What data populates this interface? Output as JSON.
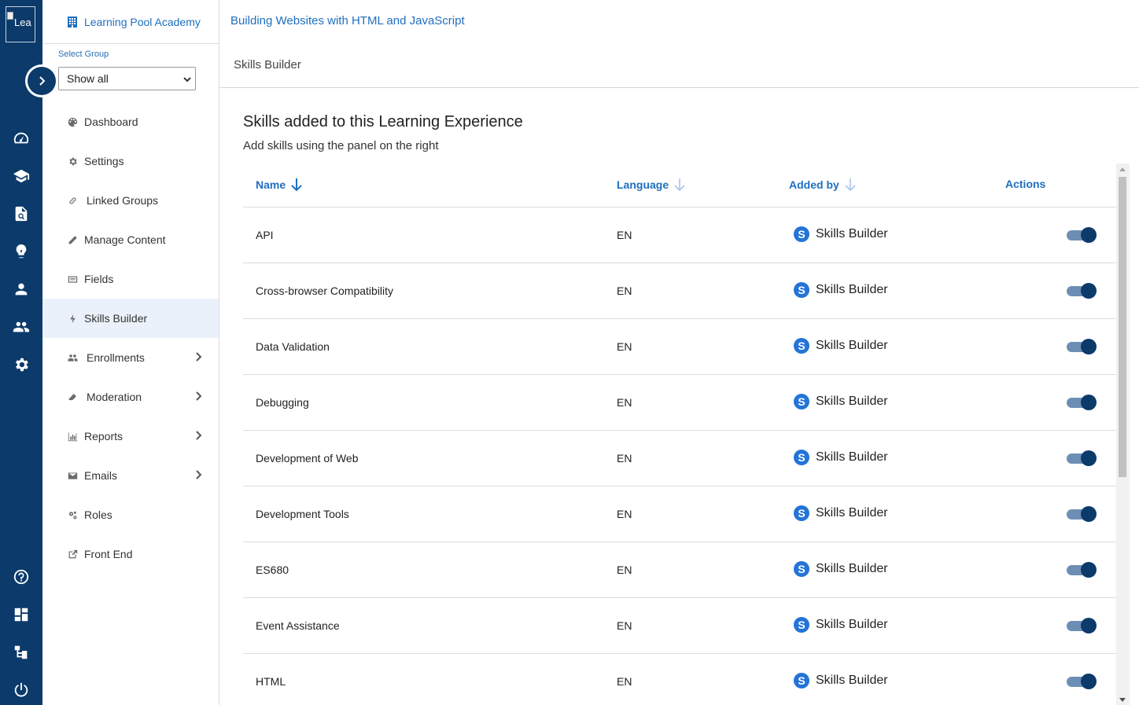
{
  "rail": {
    "logo_alt": "Lea",
    "icons": [
      "dashboard-gauge-icon",
      "graduation-cap-icon",
      "document-search-icon",
      "lightbulb-icon",
      "person-icon",
      "people-icon",
      "gear-icon",
      "help-circle-icon",
      "grid-icon",
      "hierarchy-icon",
      "power-icon"
    ]
  },
  "subnav": {
    "academy": "Learning Pool Academy",
    "group_label": "Select Group",
    "group_select_value": "Show all",
    "items": [
      {
        "label": "Dashboard",
        "icon": "palette-icon",
        "has_children": false,
        "active": false
      },
      {
        "label": "Settings",
        "icon": "gear-icon",
        "has_children": false,
        "active": false
      },
      {
        "label": "Linked Groups",
        "icon": "link-icon",
        "has_children": false,
        "active": false
      },
      {
        "label": "Manage Content",
        "icon": "pencil-icon",
        "has_children": false,
        "active": false
      },
      {
        "label": "Fields",
        "icon": "list-box-icon",
        "has_children": false,
        "active": false
      },
      {
        "label": "Skills Builder",
        "icon": "bolt-icon",
        "has_children": false,
        "active": true
      },
      {
        "label": "Enrollments",
        "icon": "users-icon",
        "has_children": true,
        "active": false
      },
      {
        "label": "Moderation",
        "icon": "eraser-icon",
        "has_children": true,
        "active": false
      },
      {
        "label": "Reports",
        "icon": "bar-chart-icon",
        "has_children": true,
        "active": false
      },
      {
        "label": "Emails",
        "icon": "envelope-icon",
        "has_children": true,
        "active": false
      },
      {
        "label": "Roles",
        "icon": "cogs-icon",
        "has_children": false,
        "active": false
      },
      {
        "label": "Front End",
        "icon": "external-link-icon",
        "has_children": false,
        "active": false
      }
    ]
  },
  "main": {
    "course_title": "Building Websites with HTML and JavaScript",
    "page_title": "Skills Builder",
    "section_title": "Skills added to this Learning Experience",
    "section_subtitle": "Add skills using the panel on the right",
    "table": {
      "headers": {
        "name": "Name",
        "language": "Language",
        "added_by": "Added by",
        "actions": "Actions"
      },
      "rows": [
        {
          "name": "API",
          "language": "EN",
          "added_by": "Skills Builder",
          "enabled": true
        },
        {
          "name": "Cross-browser Compatibility",
          "language": "EN",
          "added_by": "Skills Builder",
          "enabled": true
        },
        {
          "name": "Data Validation",
          "language": "EN",
          "added_by": "Skills Builder",
          "enabled": true
        },
        {
          "name": "Debugging",
          "language": "EN",
          "added_by": "Skills Builder",
          "enabled": true
        },
        {
          "name": "Development of Web",
          "language": "EN",
          "added_by": "Skills Builder",
          "enabled": true
        },
        {
          "name": "Development Tools",
          "language": "EN",
          "added_by": "Skills Builder",
          "enabled": true
        },
        {
          "name": "ES680",
          "language": "EN",
          "added_by": "Skills Builder",
          "enabled": true
        },
        {
          "name": "Event Assistance",
          "language": "EN",
          "added_by": "Skills Builder",
          "enabled": true
        },
        {
          "name": "HTML",
          "language": "EN",
          "added_by": "Skills Builder",
          "enabled": true
        }
      ]
    }
  },
  "colors": {
    "rail": "#0b3a6b",
    "link_blue": "#1f6fbf",
    "active_bg": "#eaf1fa",
    "badge_blue": "#2474d8",
    "toggle_track": "#6d8eb4"
  }
}
